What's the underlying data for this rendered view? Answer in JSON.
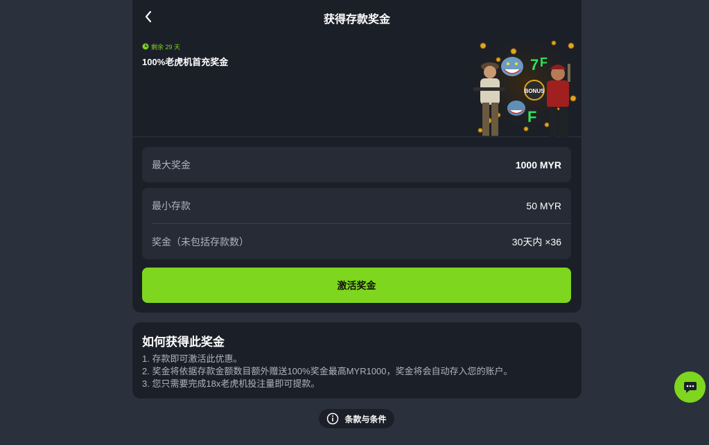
{
  "header": {
    "title": "获得存款奖金"
  },
  "promo": {
    "remaining": "剩余 29 天",
    "name": "100%老虎机首充奖金",
    "art_icon": "slot-characters-art"
  },
  "details": {
    "max_bonus_label": "最大奖金",
    "max_bonus_value": "1000 MYR",
    "min_deposit_label": "最小存款",
    "min_deposit_value": "50 MYR",
    "wager_label": "奖金（未包括存款数）",
    "wager_value": "30天内 ×36"
  },
  "activate_label": "激活奖金",
  "howto": {
    "title": "如何获得此奖金",
    "steps": [
      "1. 存款即可激活此优惠。",
      "2. 奖金将依据存款金额数目额外赠送100%奖金最高MYR1000，奖金将会自动存入您的账户。",
      "3. 您只需要完成18x老虎机投注量即可提款。"
    ]
  },
  "terms_label": "条款与条件",
  "colors": {
    "accent": "#7ed61e",
    "panel": "#1b1f27",
    "background": "#2b313c"
  }
}
